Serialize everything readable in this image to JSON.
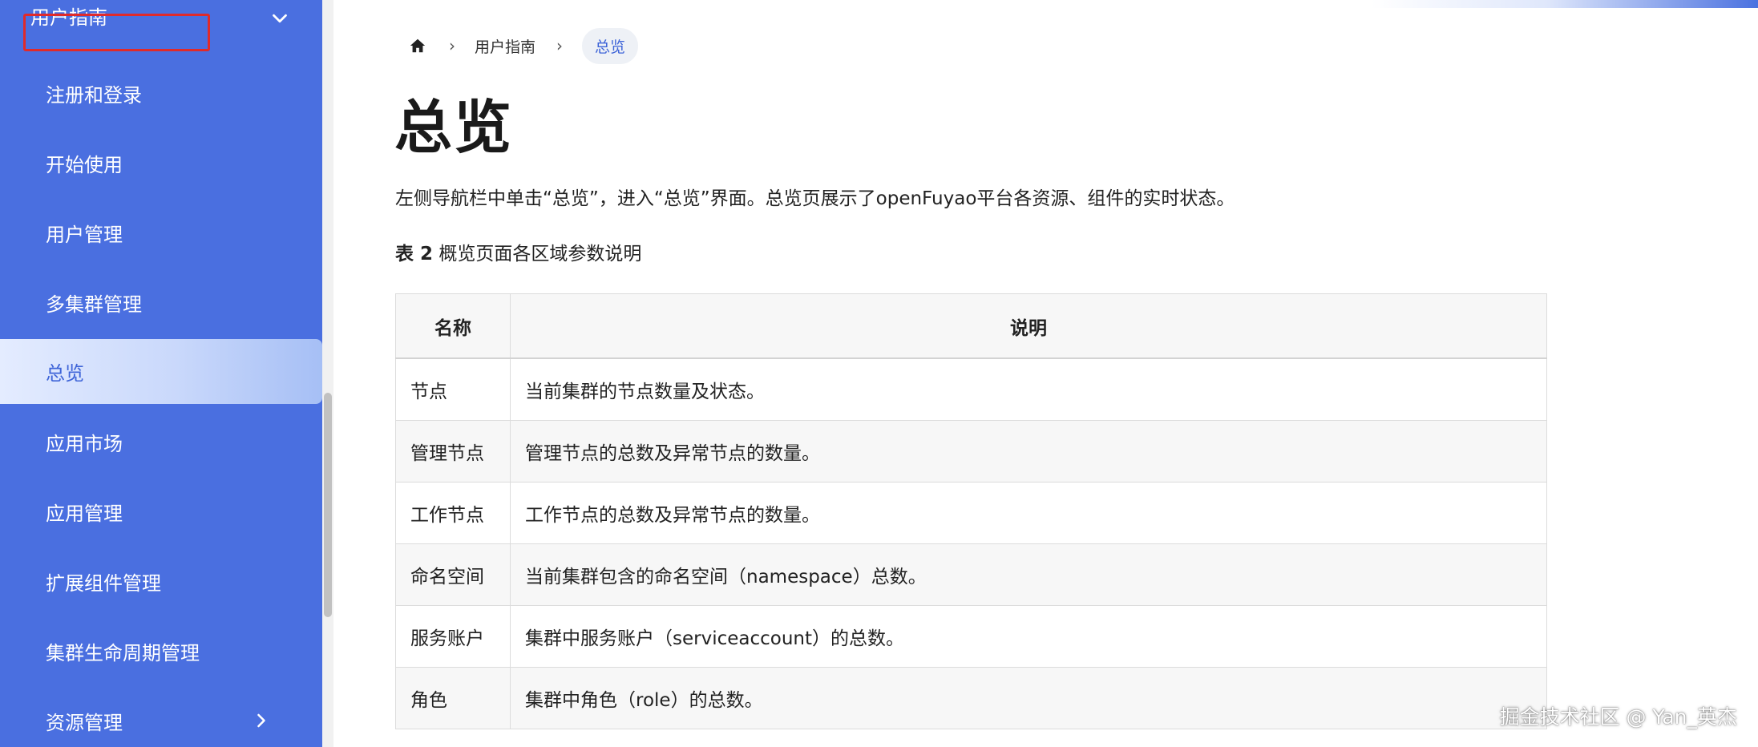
{
  "sidebar": {
    "header_label": "用户指南",
    "items": [
      {
        "label": "注册和登录"
      },
      {
        "label": "开始使用"
      },
      {
        "label": "用户管理"
      },
      {
        "label": "多集群管理"
      },
      {
        "label": "总览"
      },
      {
        "label": "应用市场"
      },
      {
        "label": "应用管理"
      },
      {
        "label": "扩展组件管理"
      },
      {
        "label": "集群生命周期管理"
      },
      {
        "label": "资源管理"
      }
    ],
    "active_item": "总览",
    "accent_color": "#4a6fe0"
  },
  "breadcrumb": {
    "items": [
      "用户指南",
      "总览"
    ]
  },
  "main": {
    "title": "总览",
    "intro": "左侧导航栏中单击“总览”，进入“总览”界面。总览页展示了openFuyao平台各资源、组件的实时状态。",
    "caption_bold": "表 2",
    "caption_text": " 概览页面各区域参数说明",
    "table": {
      "headers": [
        "名称",
        "说明"
      ],
      "rows": [
        [
          "节点",
          "当前集群的节点数量及状态。"
        ],
        [
          "管理节点",
          "管理节点的总数及异常节点的数量。"
        ],
        [
          "工作节点",
          "工作节点的总数及异常节点的数量。"
        ],
        [
          "命名空间",
          "当前集群包含的命名空间（namespace）总数。"
        ],
        [
          "服务账户",
          "集群中服务账户（serviceaccount）的总数。"
        ],
        [
          "角色",
          "集群中角色（role）的总数。"
        ]
      ]
    }
  },
  "watermark": "掘金技术社区 @ Yan_英杰"
}
